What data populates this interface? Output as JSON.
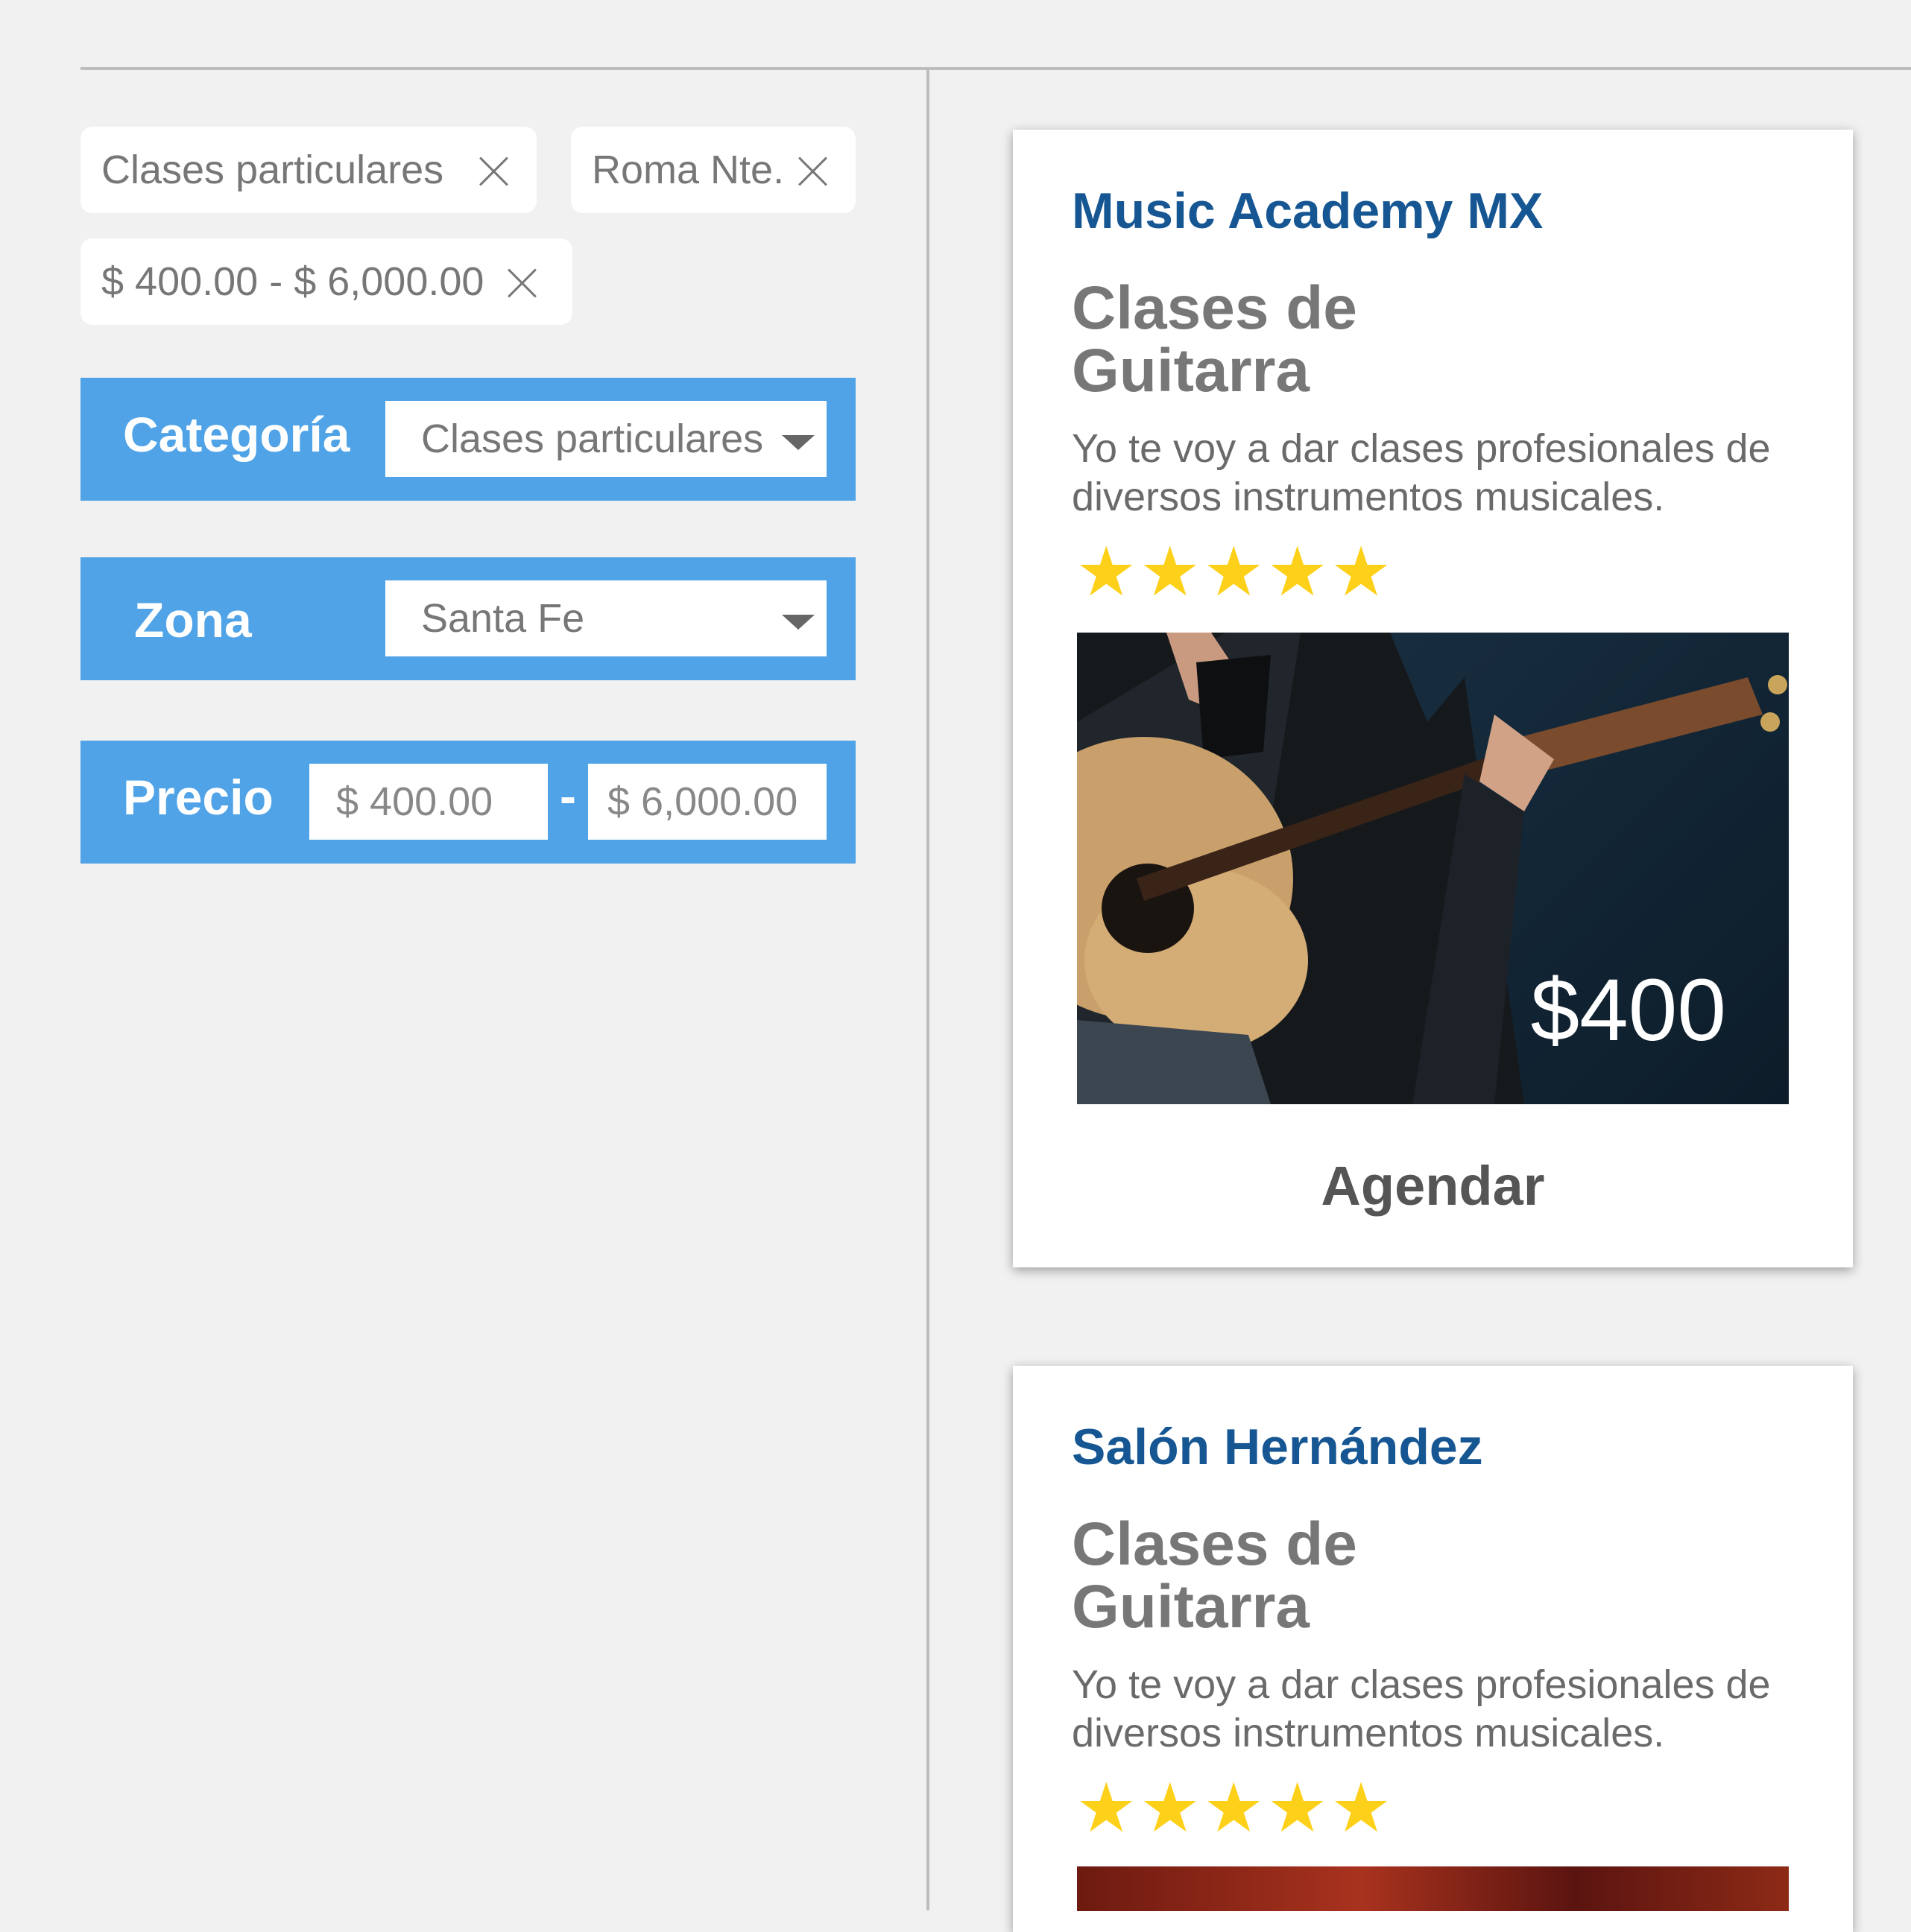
{
  "chips": [
    {
      "label": "Clases particulares"
    },
    {
      "label": "Roma Nte."
    },
    {
      "label": "$ 400.00 - $ 6,000.00"
    }
  ],
  "filters": {
    "category": {
      "label": "Categoría",
      "value": "Clases particulares"
    },
    "zone": {
      "label": "Zona",
      "value": "Santa Fe"
    },
    "price": {
      "label": "Precio",
      "min": "$ 400.00",
      "separator": "-",
      "max": "$ 6,000.00"
    }
  },
  "listings": [
    {
      "provider": "Music Academy MX",
      "title_line1": "Clases de",
      "title_line2": "Guitarra",
      "description": "Yo te voy a dar clases profesionales de diversos instrumentos musicales.",
      "rating": 5,
      "stars": "★★★★★",
      "price": "$400",
      "cta": "Agendar"
    },
    {
      "provider": "Salón Hernández",
      "title_line1": "Clases de",
      "title_line2": "Guitarra",
      "description": "Yo te voy a dar clases profesionales de diversos instrumentos musicales.",
      "rating": 5,
      "stars": "★★★★★"
    }
  ],
  "colors": {
    "accent": "#4fa3e6",
    "provider_text": "#155693",
    "star": "#fdd01a",
    "background": "#f1f1f1"
  }
}
